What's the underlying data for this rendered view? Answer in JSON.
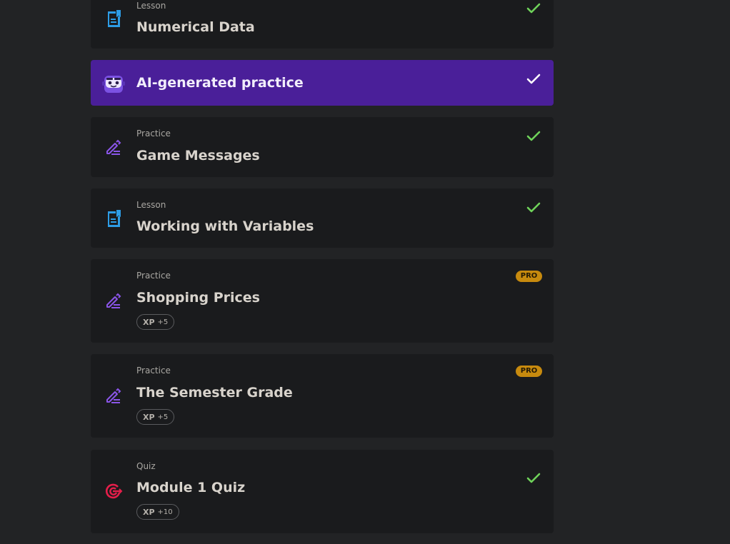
{
  "items": [
    {
      "kind": "Lesson",
      "title": "Numerical Data",
      "icon": "lesson-icon",
      "status": "completed"
    },
    {
      "kind": "",
      "title": "AI-generated practice",
      "icon": "robot-mascot-icon",
      "status": "completed"
    },
    {
      "kind": "Practice",
      "title": "Game Messages",
      "icon": "practice-pencil-icon",
      "status": "completed"
    },
    {
      "kind": "Lesson",
      "title": "Working with Variables",
      "icon": "lesson-icon",
      "status": "completed"
    },
    {
      "kind": "Practice",
      "title": "Shopping Prices",
      "icon": "practice-pencil-icon",
      "badge": "PRO",
      "xp_label": "XP",
      "xp_amount": "+5"
    },
    {
      "kind": "Practice",
      "title": "The Semester Grade",
      "icon": "practice-pencil-icon",
      "badge": "PRO",
      "xp_label": "XP",
      "xp_amount": "+5"
    },
    {
      "kind": "Quiz",
      "title": "Module 1 Quiz",
      "icon": "quiz-target-icon",
      "status": "completed",
      "xp_label": "XP",
      "xp_amount": "+10"
    }
  ],
  "colors": {
    "background": "#222325",
    "card": "#1a1b1d",
    "ai_card": "#4a1f99",
    "check": "#6fd35a",
    "lesson_icon": "#2d9de6",
    "practice_icon": "#8a55e8",
    "quiz_icon": "#e51e4a",
    "pro_badge": "#c78a0e"
  }
}
